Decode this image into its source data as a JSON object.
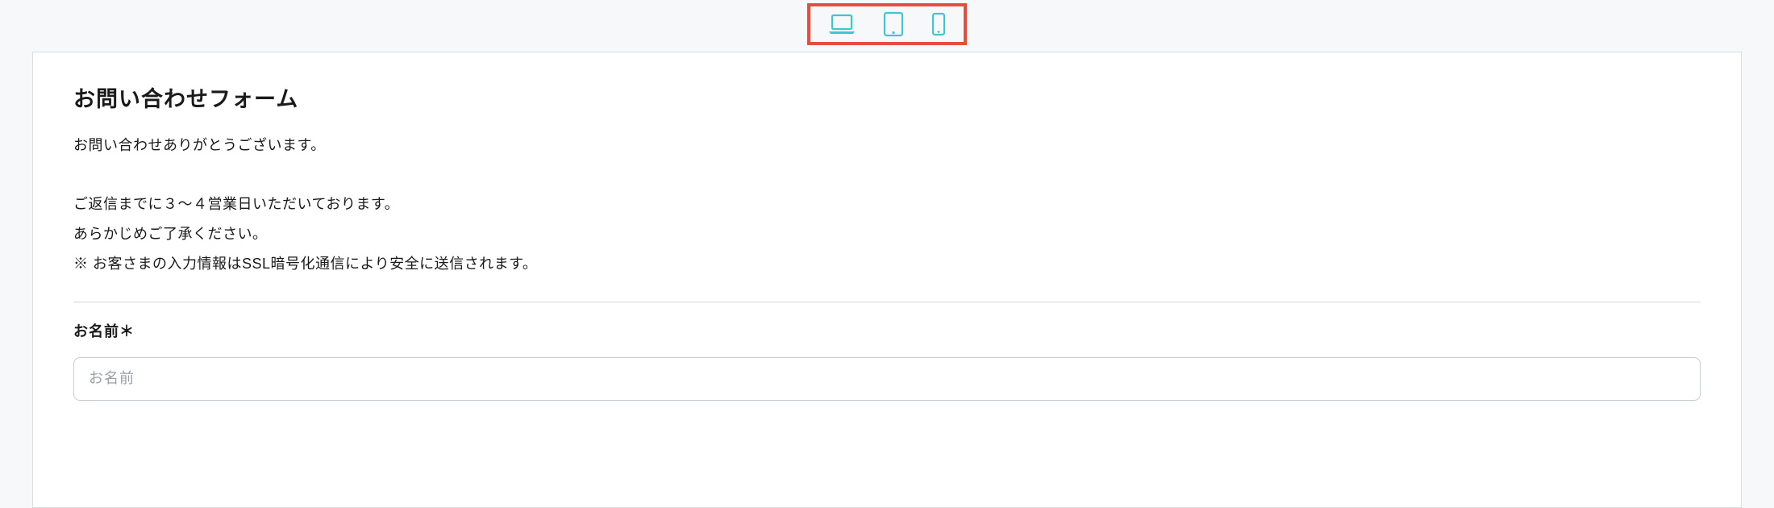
{
  "toolbar": {
    "devices": {
      "desktop_name": "laptop-icon",
      "tablet_name": "tablet-icon",
      "mobile_name": "mobile-icon"
    },
    "icon_color": "#3fc7cf",
    "highlight_color": "#e74c3c"
  },
  "form": {
    "title": "お問い合わせフォーム",
    "intro_line1": "お問い合わせありがとうございます。",
    "intro_line2": "ご返信までに３〜４営業日いただいております。",
    "intro_line3": "あらかじめご了承ください。",
    "intro_line4": "※ お客さまの入力情報はSSL暗号化通信により安全に送信されます。",
    "fields": {
      "name": {
        "label": "お名前＊",
        "placeholder": "お名前",
        "value": ""
      }
    }
  }
}
